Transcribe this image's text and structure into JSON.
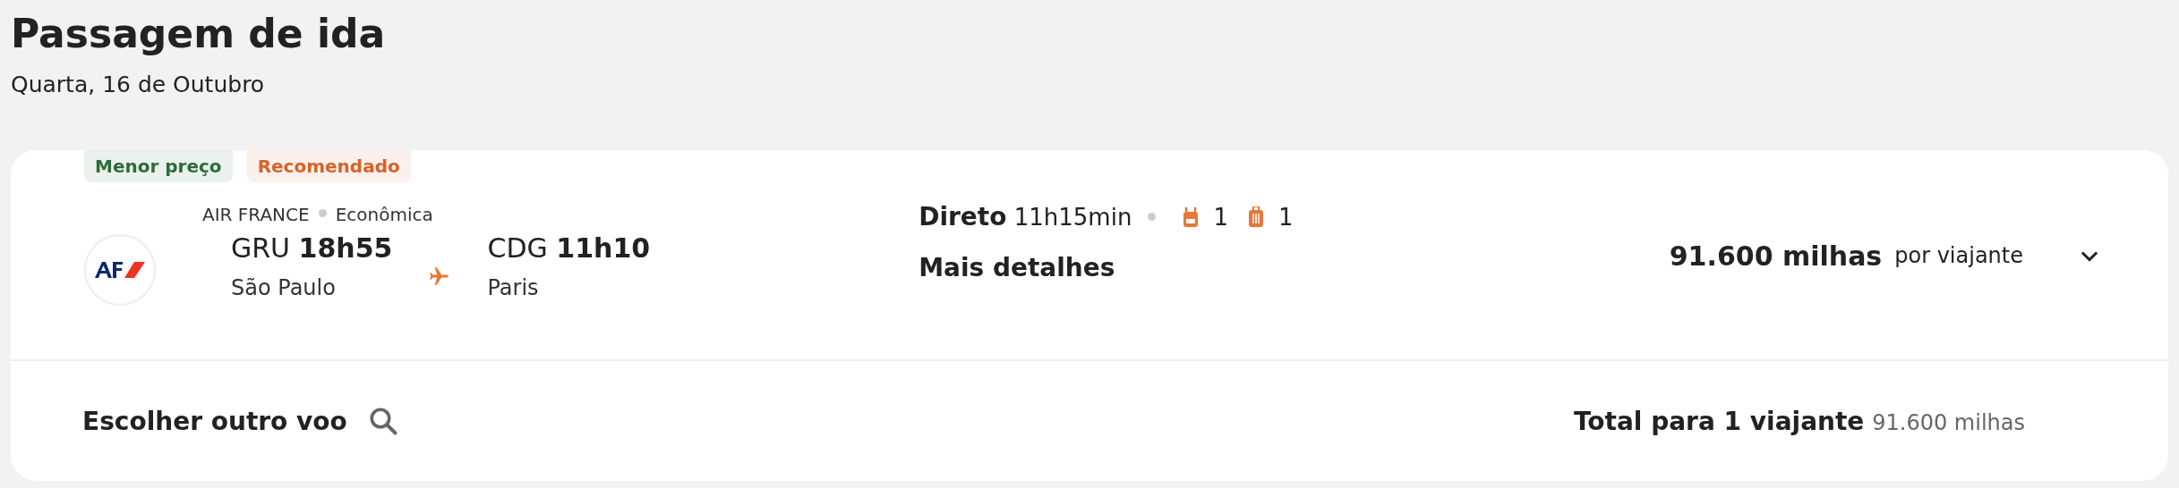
{
  "header": {
    "title": "Passagem de ida",
    "subtitle": "Quarta, 16 de Outubro"
  },
  "flight": {
    "tags": [
      {
        "label": "Menor preço",
        "color": "#2e6b3a"
      },
      {
        "label": "Recomendado",
        "color": "#d8622a"
      }
    ],
    "airline": "AIR FRANCE",
    "cabin": "Econômica",
    "departure": {
      "code": "GRU",
      "time": "18h55",
      "city": "São Paulo"
    },
    "arrival": {
      "code": "CDG",
      "time": "11h10",
      "city": "Paris"
    },
    "stops": "Direto",
    "duration": "11h15min",
    "baggage": [
      {
        "kind": "backpack",
        "count": "1"
      },
      {
        "kind": "suitcase",
        "count": "1"
      }
    ],
    "details_link": "Mais detalhes",
    "price": "91.600 milhas",
    "price_note": "por viajante",
    "expanded": false
  },
  "footer": {
    "change_flight": "Escolher outro voo",
    "total_label": "Total para 1 viajante",
    "total_value": "91.600 milhas"
  }
}
